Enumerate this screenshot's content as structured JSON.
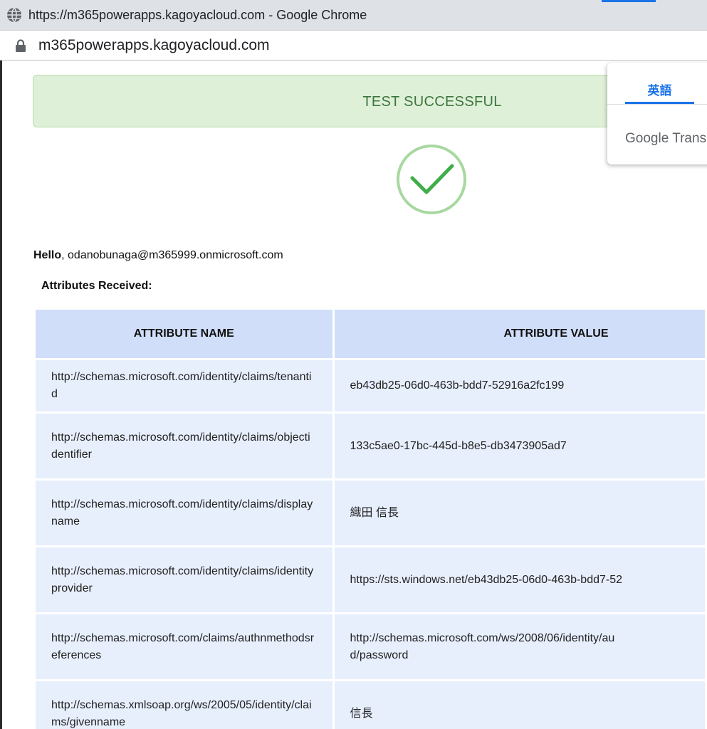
{
  "window": {
    "title": "https://m365powerapps.kagoyacloud.com - Google Chrome",
    "globe_icon": "globe-icon"
  },
  "address_bar": {
    "url": "m365powerapps.kagoyacloud.com",
    "lock_icon": "lock-icon"
  },
  "result": {
    "banner": "TEST SUCCESSFUL",
    "check_icon": "checkmark-circle-icon",
    "colors": {
      "banner_bg": "#dff0d8",
      "banner_text": "#3c763d",
      "check": "#3fae49",
      "ring": "#a8d8a0"
    }
  },
  "greeting": {
    "hello_label": "Hello",
    "user": ", odanobunaga@m365999.onmicrosoft.com"
  },
  "attributes": {
    "heading": "Attributes Received:",
    "headers": {
      "name": "ATTRIBUTE NAME",
      "value": "ATTRIBUTE VALUE"
    },
    "rows": [
      {
        "name": "http://schemas.microsoft.com/identity/claims/tenantid",
        "value": "eb43db25-06d0-463b-bdd7-52916a2fc199"
      },
      {
        "name": "http://schemas.microsoft.com/identity/claims/objectidentifier",
        "value": "133c5ae0-17bc-445d-b8e5-db3473905ad7"
      },
      {
        "name": "http://schemas.microsoft.com/identity/claims/displayname",
        "value": "織田 信長"
      },
      {
        "name": "http://schemas.microsoft.com/identity/claims/identityprovider",
        "value": "https://sts.windows.net/eb43db25-06d0-463b-bdd7-52"
      },
      {
        "name": "http://schemas.microsoft.com/claims/authnmethodsreferences",
        "value": "http://schemas.microsoft.com/ws/2008/06/identity/au\nd/password"
      },
      {
        "name": "http://schemas.xmlsoap.org/ws/2005/05/identity/claims/givenname",
        "value": "信長"
      }
    ]
  },
  "translate": {
    "tab_label": "英語",
    "brand": "Google Transla"
  }
}
